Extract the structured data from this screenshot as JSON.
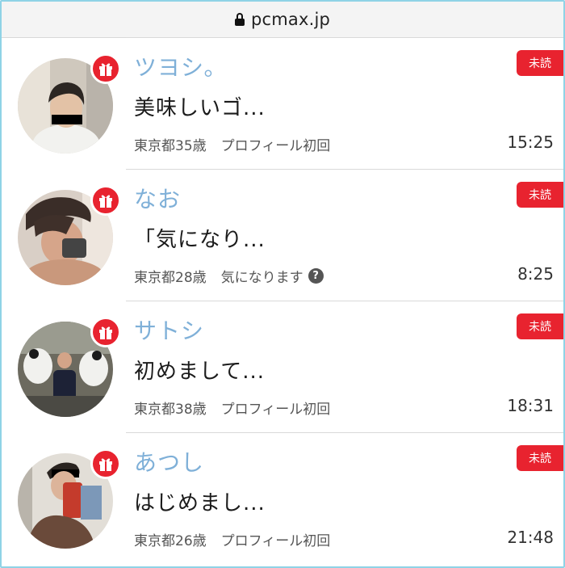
{
  "browser": {
    "url": "pcmax.jp"
  },
  "messages": [
    {
      "name": "ツヨシ。",
      "badge": "未読",
      "preview": "美味しいゴ...",
      "location": "東京都",
      "age": "35歳",
      "note": "プロフィール初回",
      "time": "15:25",
      "has_help": false
    },
    {
      "name": "なお",
      "badge": "未読",
      "preview": "「気になり...",
      "location": "東京都",
      "age": "28歳",
      "note": "気になります",
      "time": "8:25",
      "has_help": true
    },
    {
      "name": "サトシ",
      "badge": "未読",
      "preview": "初めまして...",
      "location": "東京都",
      "age": "38歳",
      "note": "プロフィール初回",
      "time": "18:31",
      "has_help": false
    },
    {
      "name": "あつし",
      "badge": "未読",
      "preview": "はじめまし...",
      "location": "東京都",
      "age": "26歳",
      "note": "プロフィール初回",
      "time": "21:48",
      "has_help": false
    }
  ],
  "help_glyph": "?",
  "colors": {
    "accent_red": "#e8232f",
    "name_blue": "#7fb0d8",
    "url_border": "#8fd3e6"
  },
  "icons": {
    "lock": "lock-icon",
    "gift": "gift-icon",
    "help": "question-circle-icon"
  }
}
